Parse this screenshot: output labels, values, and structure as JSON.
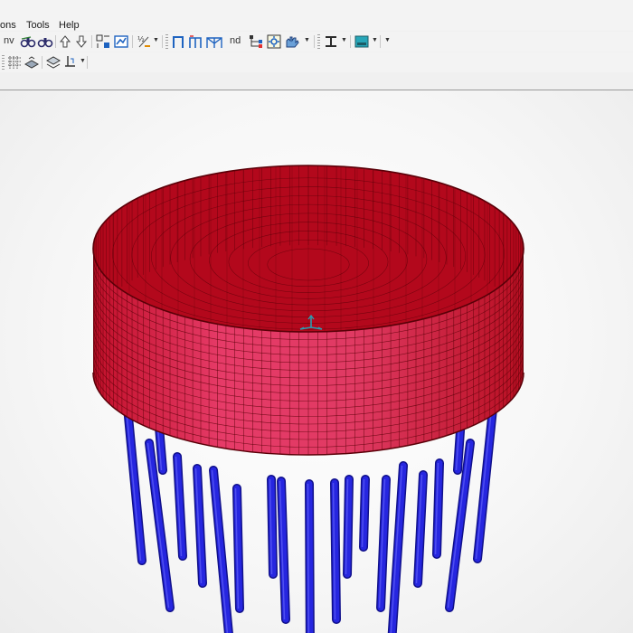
{
  "menu": {
    "items": [
      "ons",
      "Tools",
      "Help"
    ]
  },
  "toolbar": {
    "text_nv": "nv",
    "text_nd": "nd",
    "icons_row1": [
      "binoculars-icon",
      "binoculars-icon",
      "arrow-up-icon",
      "arrow-down-icon",
      "select-icon",
      "chart-icon",
      "fraction-icon",
      "frame-icon",
      "frame-2-icon",
      "frame-3-icon",
      "tree-icon",
      "gear-icon",
      "hand-icon",
      "beam-icon",
      "color-icon"
    ],
    "icons_row2": [
      "grid-icon",
      "slab-icon",
      "layers-icon",
      "support-icon"
    ]
  },
  "colors": {
    "tank_fill": "#d11a2a",
    "tank_mesh": "#5a0008",
    "tank_wall_light": "#e0355a",
    "pile_fill": "#2626e0",
    "pile_dark": "#10108a",
    "axis": "#2a9db0"
  },
  "model": {
    "type": "cylindrical tank on piles",
    "piles_visible": 20
  }
}
